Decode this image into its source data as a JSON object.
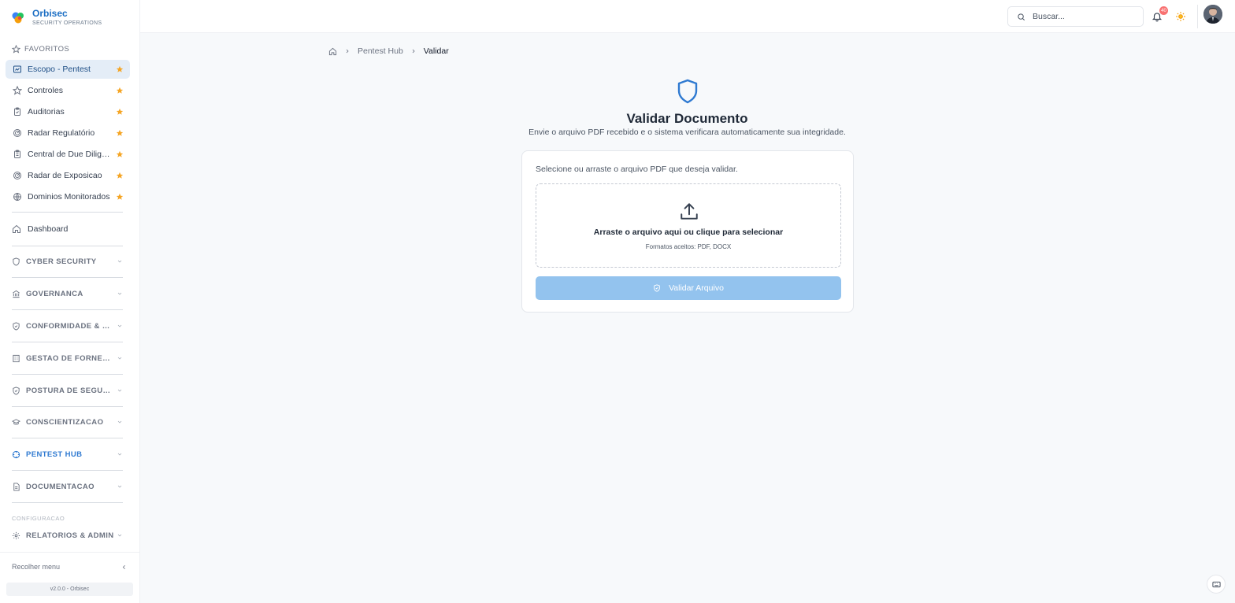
{
  "brand": {
    "name": "Orbisec",
    "subtitle": "SECURITY OPERATIONS"
  },
  "sidebar": {
    "favorites_header": "FAVORITOS",
    "favorites": [
      {
        "label": "Escopo - Pentest",
        "icon": "scope-icon",
        "active": true
      },
      {
        "label": "Controles",
        "icon": "star-outline-icon"
      },
      {
        "label": "Auditorias",
        "icon": "clipboard-icon"
      },
      {
        "label": "Radar Regulatório",
        "icon": "radar-icon"
      },
      {
        "label": "Central de Due Diligence",
        "icon": "clipboard-list-icon"
      },
      {
        "label": "Radar de Exposicao",
        "icon": "radar-icon"
      },
      {
        "label": "Dominios Monitorados",
        "icon": "globe-icon"
      }
    ],
    "dashboard": "Dashboard",
    "sections": [
      {
        "label": "CYBER SECURITY",
        "icon": "shield-icon"
      },
      {
        "label": "GOVERNANCA",
        "icon": "bank-icon"
      },
      {
        "label": "CONFORMIDADE & RISCOS",
        "icon": "shield-check-icon"
      },
      {
        "label": "GESTAO DE FORNECEDORES",
        "icon": "building-icon"
      },
      {
        "label": "POSTURA DE SEGURANCA",
        "icon": "shield-check-icon"
      },
      {
        "label": "CONSCIENTIZACAO",
        "icon": "graduation-cap-icon"
      },
      {
        "label": "PENTEST HUB",
        "icon": "crosshair-icon",
        "active": true
      },
      {
        "label": "DOCUMENTACAO",
        "icon": "document-icon"
      }
    ],
    "config_label": "CONFIGURACAO",
    "admin_section": {
      "label": "RELATORIOS & ADMIN",
      "icon": "gear-icon"
    },
    "collapse_label": "Recolher menu",
    "version": "v2.0.0 - Orbisec"
  },
  "header": {
    "search_placeholder": "Buscar...",
    "notification_count": "40"
  },
  "breadcrumb": {
    "parent": "Pentest Hub",
    "current": "Validar"
  },
  "main": {
    "title": "Validar Documento",
    "subtitle": "Envie o arquivo PDF recebido e o sistema verificara automaticamente sua integridade.",
    "card_label": "Selecione ou arraste o arquivo PDF que deseja validar.",
    "dropzone_main": "Arraste o arquivo aqui ou clique para selecionar",
    "dropzone_sub": "Formatos aceitos: PDF, DOCX",
    "validate_button": "Validar Arquivo"
  },
  "colors": {
    "accent": "#2f7ad1",
    "active_bg": "#e4edf7",
    "star": "#f5a524",
    "button_disabled": "#93c3ee"
  }
}
